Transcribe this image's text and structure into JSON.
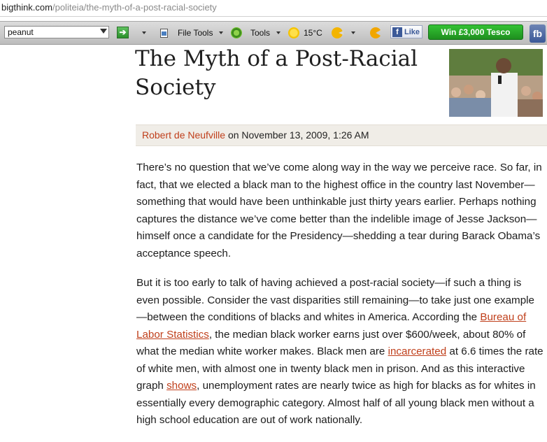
{
  "url": {
    "domain": "bigthink.com",
    "path": "/politeia/the-myth-of-a-post-racial-society"
  },
  "toolbar": {
    "search_value": "peanut",
    "file_tools_label": "File Tools",
    "tools_label": "Tools",
    "weather_label": "15°C",
    "like_label": "Like",
    "win_label": "Win £3,000 Tesco",
    "fb_label": "fb",
    "icons": [
      "search-dropdown-icon",
      "go-arrow-icon",
      "document-icon",
      "gear-icon",
      "sun-icon",
      "face-icon",
      "pacman-icon",
      "facebook-icon"
    ]
  },
  "article": {
    "title": "The Myth of a Post-Racial Society",
    "photo_alt": "Barack Obama speaking into a microphone in front of a crowd",
    "byline": {
      "author": "Robert de Neufville",
      "date_text": " on November 13, 2009, 1:26 AM"
    },
    "paragraph1": "There’s no question that we’ve come along way in the way we perceive race. So far, in fact, that we elected a black man to the highest office in the country last November—something that would have been unthinkable just thirty years earlier. Perhaps nothing captures the distance we’ve come better than the indelible image of Jesse Jackson—himself once a candidate for the Presidency—shedding a tear during Barack Obama’s acceptance speech.",
    "paragraph2": {
      "t1": "But it is too early to talk of having achieved a post-racial society—if such a thing is even possible. Consider the vast disparities still remaining—to take just one example—between the conditions of blacks and whites in America. According the ",
      "link1": "Bureau of Labor Statistics",
      "t2": ", the median black worker earns just over $600/week, about 80% of what the median white worker makes. Black men are ",
      "link2": "incarcerated",
      "t3": " at 6.6 times the rate of white men, with almost one in twenty black men in prison. And as this interactive graph ",
      "link3": "shows",
      "t4": ", unemployment rates are nearly twice as high for blacks as for whites in essentially every demographic category. Almost half of all young black men without a high school education are out of work nationally."
    }
  }
}
